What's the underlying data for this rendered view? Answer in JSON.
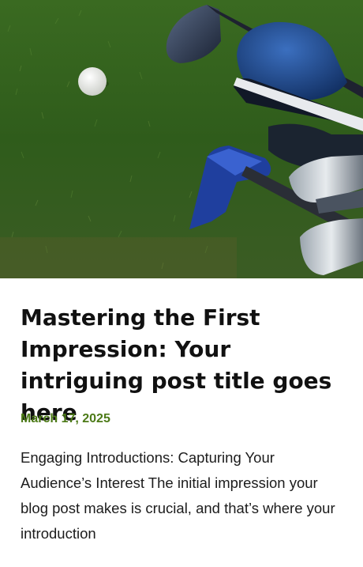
{
  "post": {
    "image": {
      "alt_icon": "golf-clubs-and-ball-photo"
    },
    "title": "Mastering the First Impression: Your intriguing post title goes here",
    "date": "March 17, 2025",
    "excerpt": "Engaging Introductions: Capturing Your Audience’s Interest The initial impression your blog post makes is crucial, and that’s where your introduction"
  },
  "colors": {
    "title": "#111111",
    "date": "#4c7a17",
    "excerpt": "#1c1c1c",
    "grass": "#3d6b22"
  }
}
